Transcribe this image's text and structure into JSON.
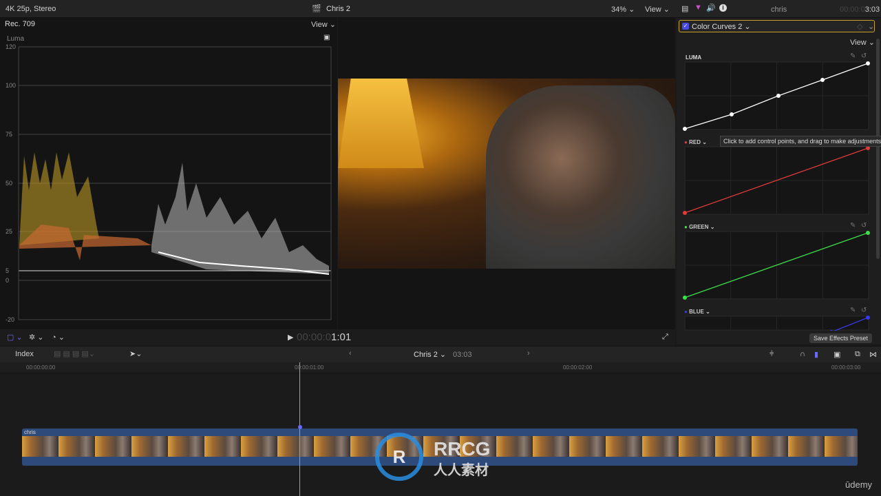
{
  "topbar": {
    "format": "4K 25p, Stereo",
    "project": "Chris 2",
    "zoom": "34%",
    "view": "View",
    "clip_name": "chris",
    "timecode_dim": "00:00:0",
    "timecode": "3:03"
  },
  "scope": {
    "standard": "Rec. 709",
    "view": "View",
    "mode": "Luma",
    "scale": [
      "120",
      "100",
      "75",
      "50",
      "25",
      "5",
      "0",
      "-20"
    ]
  },
  "inspector": {
    "effect": "Color Curves 2",
    "effect_enabled": true,
    "view": "View",
    "curves": [
      {
        "label": "LUMA",
        "color": "#ffffff"
      },
      {
        "label": "RED",
        "color": "#e03a3a"
      },
      {
        "label": "GREEN",
        "color": "#3ee04a"
      },
      {
        "label": "BLUE",
        "color": "#3a3ae8"
      }
    ],
    "tooltip": "Click to add control points, and drag to make adjustments",
    "save_preset": "Save Effects Preset"
  },
  "viewer": {
    "timecode_dim": "00:00:0",
    "timecode": "1:01"
  },
  "timeline": {
    "index": "Index",
    "project": "Chris 2",
    "duration": "03:03",
    "ruler": [
      "00:00:00:00",
      "00:00:01:00",
      "00:00:02:00",
      "00:00:03:00"
    ],
    "clip": "chris"
  },
  "watermark": {
    "brand": "RRCG",
    "sub": "人人素材",
    "udemy": "ūdemy"
  }
}
